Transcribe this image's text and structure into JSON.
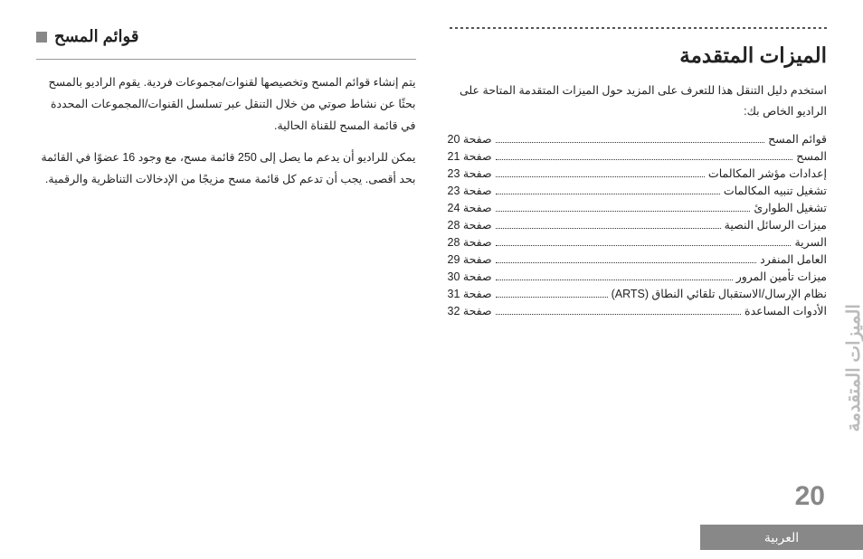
{
  "main_title": "الميزات المتقدمة",
  "intro_text": "استخدم دليل التنقل هذا للتعرف على المزيد حول الميزات المتقدمة المتاحة على الراديو الخاص بك:",
  "page_word": "صفحة",
  "toc": [
    {
      "label": "قوائم المسح",
      "page": "20"
    },
    {
      "label": "المسح",
      "page": "21"
    },
    {
      "label": "إعدادات مؤشر المكالمات",
      "page": "23"
    },
    {
      "label": "تشغيل تنبيه المكالمات",
      "page": "23"
    },
    {
      "label": "تشغيل الطوارئ",
      "page": "24"
    },
    {
      "label": "ميزات الرسائل النصية",
      "page": "28"
    },
    {
      "label": "السرية",
      "page": "28"
    },
    {
      "label": "العامل المنفرد",
      "page": "29"
    },
    {
      "label": "ميزات تأمين المرور",
      "page": "30"
    },
    {
      "label": "نظام الإرسال/الاستقبال تلقائي النطاق (ARTS)",
      "page": "31"
    },
    {
      "label": "الأدوات المساعدة",
      "page": "32"
    }
  ],
  "section_title": "قوائم المسح",
  "para1": "يتم إنشاء قوائم المسح وتخصيصها لقنوات/مجموعات فردية. يقوم الراديو بالمسح بحثًا عن نشاط صوتي من خلال التنقل عبر تسلسل القنوات/المجموعات المحددة في قائمة المسح للقناة الحالية.",
  "para2": "يمكن للراديو أن يدعم ما يصل إلى 250 قائمة مسح، مع وجود 16 عضوًا في القائمة بحد أقصى. يجب أن تدعم كل قائمة مسح مزيجًا من الإدخالات التناظرية والرقمية.",
  "page_number": "20",
  "side_tab_text": "الميزات المتقدمة",
  "language": "العربية"
}
